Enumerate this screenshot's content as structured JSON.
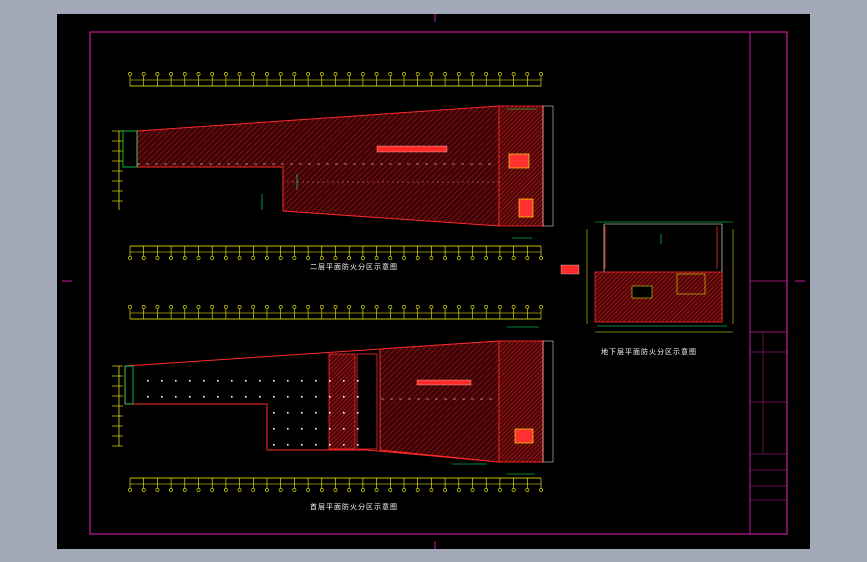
{
  "drawing": {
    "title_top": "二层平面防火分区示意图",
    "title_bottom": "首层平面防火分区示意图",
    "title_basement": "地下层平面防火分区示意图"
  },
  "title_block": {
    "rows": [
      "",
      "",
      "",
      "",
      "",
      ""
    ],
    "logo_text": "",
    "sheet_no": ""
  },
  "colors": {
    "background": "#a4a9ba",
    "sheet": "#000000",
    "frame": "#c8199b",
    "axis": "#ffff00",
    "outline": "#ff2020",
    "hatch": "#7a0b10",
    "annotation": "#00ff66",
    "label": "#ffffff"
  },
  "icons": {
    "axis_marker": "axis-bubble-icon",
    "hatch": "fire-zone-hatch"
  }
}
